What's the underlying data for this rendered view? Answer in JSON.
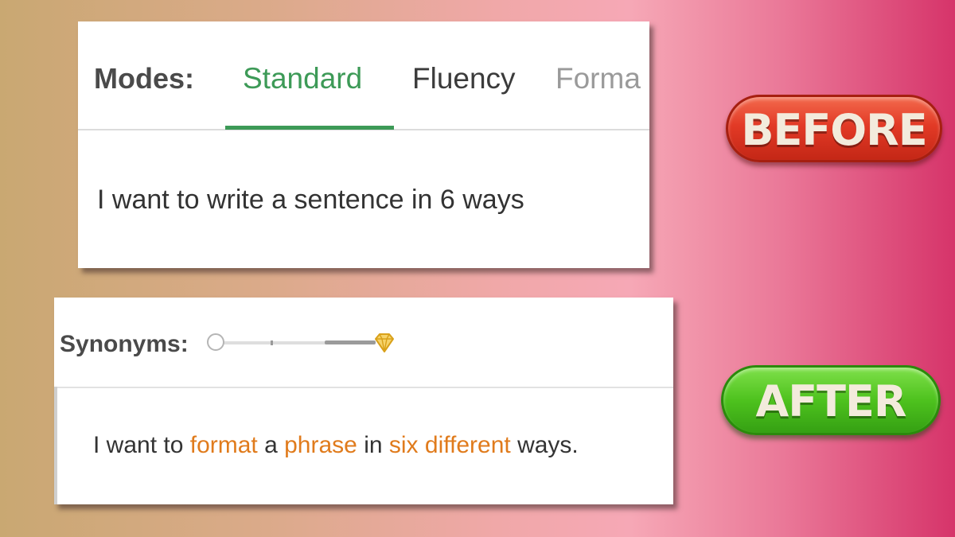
{
  "before": {
    "modes_label": "Modes:",
    "tabs": [
      {
        "label": "Standard",
        "active": true
      },
      {
        "label": "Fluency",
        "active": false
      },
      {
        "label": "Forma",
        "active": false
      }
    ],
    "input_text": "I want to write a sentence in 6 ways",
    "accent_color": "#3d9a57"
  },
  "after": {
    "synonyms_label": "Synonyms:",
    "synonyms_slider": {
      "level": 0,
      "locked_end_icon": "diamond-icon"
    },
    "output_segments": [
      {
        "text": "I want to ",
        "changed": false
      },
      {
        "text": "format",
        "changed": true
      },
      {
        "text": " a ",
        "changed": false
      },
      {
        "text": "phrase",
        "changed": true
      },
      {
        "text": " in ",
        "changed": false
      },
      {
        "text": "six different",
        "changed": true
      },
      {
        "text": " ways.",
        "changed": false
      }
    ],
    "highlight_color": "#e07b1c"
  },
  "badges": {
    "before": "BEFORE",
    "after": "AFTER"
  }
}
